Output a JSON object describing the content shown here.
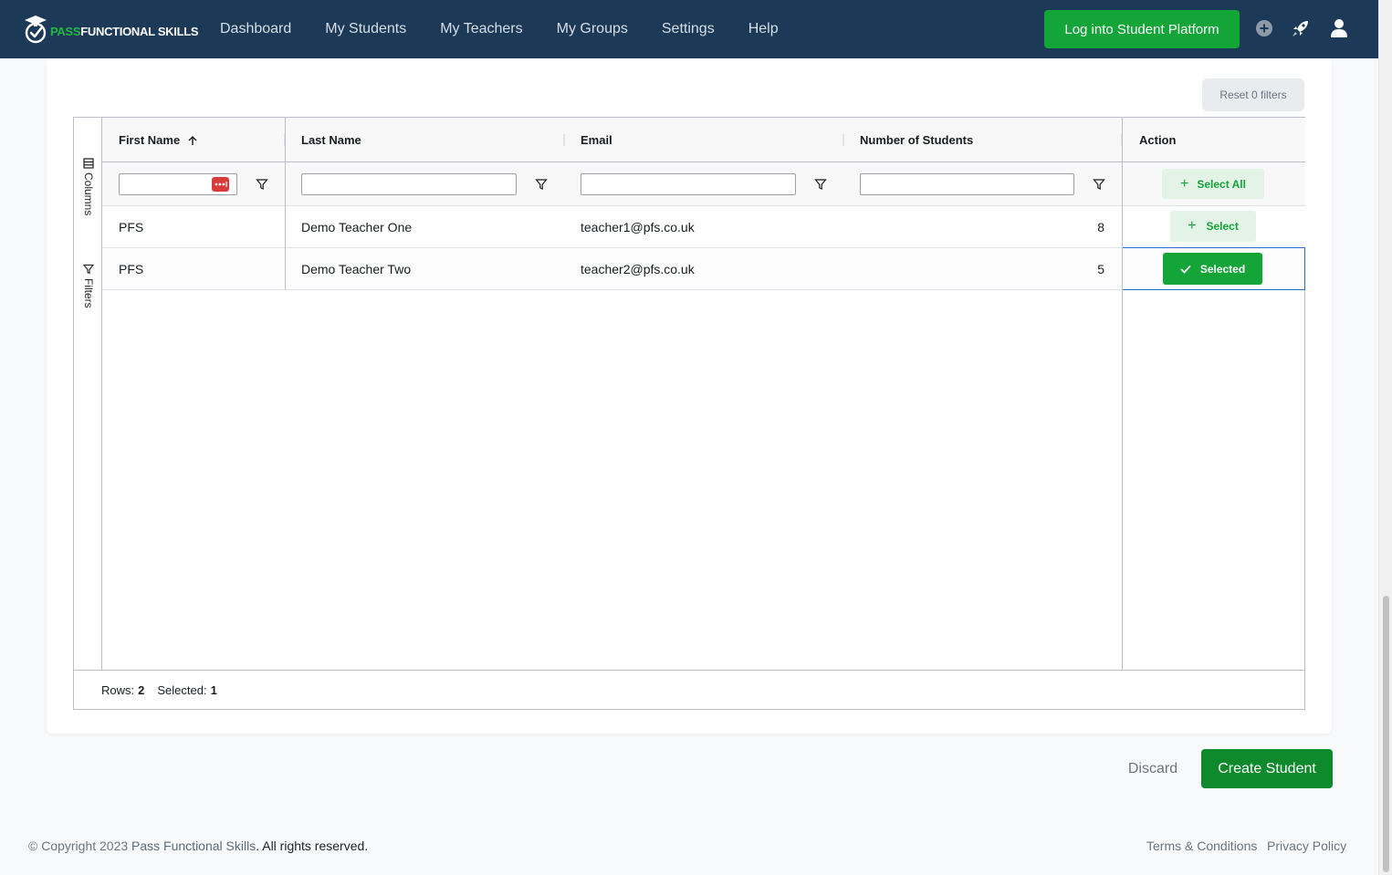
{
  "brand": {
    "pass": "PASS",
    "rest": "FUNCTIONAL SKILLS"
  },
  "nav": {
    "items": [
      "Dashboard",
      "My Students",
      "My Teachers",
      "My Groups",
      "Settings",
      "Help"
    ],
    "login_label": "Log into Student Platform",
    "icons": [
      "plus-circle-icon",
      "rocket-icon",
      "user-icon"
    ]
  },
  "toolbar": {
    "reset_label": "Reset 0 filters"
  },
  "grid": {
    "side_tabs": {
      "columns": "Columns",
      "filters": "Filters"
    },
    "columns": [
      "First Name",
      "Last Name",
      "Email",
      "Number of Students",
      "Action"
    ],
    "sort": {
      "column": "First Name",
      "direction": "ascending"
    },
    "select_all_label": "Select All",
    "rows": [
      {
        "first_name": "PFS",
        "last_name": "Demo Teacher One",
        "email": "teacher1@pfs.co.uk",
        "students": "8",
        "action": "Select",
        "selected": false
      },
      {
        "first_name": "PFS",
        "last_name": "Demo Teacher Two",
        "email": "teacher2@pfs.co.uk",
        "students": "5",
        "action": "Selected",
        "selected": true
      }
    ],
    "status": {
      "rows_label": "Rows:",
      "rows_value": "2",
      "selected_label": "Selected:",
      "selected_value": "1"
    }
  },
  "actions": {
    "discard": "Discard",
    "create": "Create Student"
  },
  "footer": {
    "copyright": "© Copyright 2023 ",
    "company": "Pass Functional Skills",
    "rights": ". All rights reserved.",
    "terms": "Terms & Conditions",
    "privacy": "Privacy Policy"
  },
  "colors": {
    "nav_bg": "#1c3a57",
    "accent_green": "#13a538",
    "create_green": "#0e8a2c",
    "brand_green": "#1fb843"
  }
}
